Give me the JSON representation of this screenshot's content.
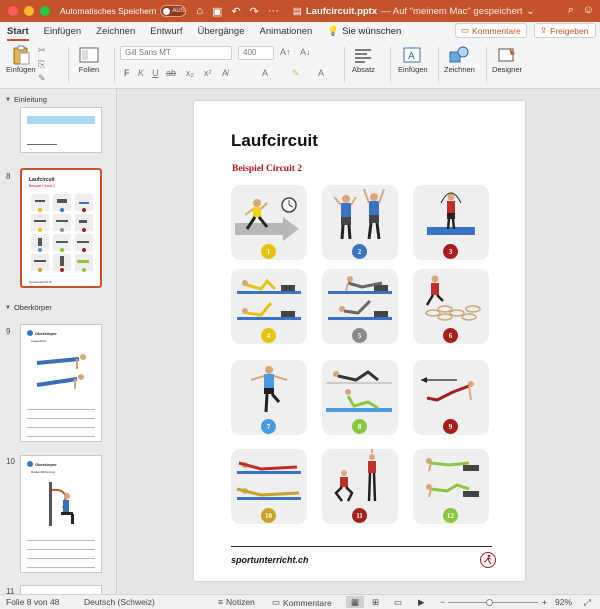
{
  "titlebar": {
    "autosave_label": "Automatisches Speichern",
    "autosave_toggle": "AUS",
    "file_name": "Laufcircuit.pptx",
    "saved_status": "— Auf \"meinem Mac\" gespeichert",
    "chevron": "⌄"
  },
  "tabs": [
    "Start",
    "Einfügen",
    "Zeichnen",
    "Entwurf",
    "Übergänge",
    "Animationen"
  ],
  "tellme": "Sie wünschen",
  "comments_button": "Kommentare",
  "share_button": "Freigeben",
  "ribbon": {
    "paste_label": "Einfügen",
    "slides_label": "Folien",
    "font_name": "Gill Sans MT",
    "font_size": "400",
    "paragraph_label": "Absatz",
    "insert_label": "Einfügen",
    "draw_label": "Zeichnen",
    "designer_label": "Designer"
  },
  "sidebar": {
    "sections": [
      {
        "label": "Einleitung"
      },
      {
        "label": "Oberkörper"
      }
    ],
    "slides": [
      {
        "number": "8"
      },
      {
        "number": "9",
        "title": "Oberkörper",
        "sub": "Liegestütze"
      },
      {
        "number": "10",
        "title": "Oberkörper",
        "sub": "Rudern/Klimmzug"
      },
      {
        "number": "11"
      }
    ],
    "thumb_footer": "sportunterricht.ch"
  },
  "slide": {
    "title": "Laufcircuit",
    "subtitle": "Beispiel Circuit 2",
    "footer": "sportunterricht.ch",
    "stations": [
      {
        "num": "1",
        "color": "#e8c20f"
      },
      {
        "num": "2",
        "color": "#3a73c4"
      },
      {
        "num": "3",
        "color": "#a51f1f"
      },
      {
        "num": "4",
        "color": "#e8c20f"
      },
      {
        "num": "5",
        "color": "#8a8a8a"
      },
      {
        "num": "6",
        "color": "#a51f1f"
      },
      {
        "num": "7",
        "color": "#4a9be0"
      },
      {
        "num": "8",
        "color": "#8cc63f"
      },
      {
        "num": "9",
        "color": "#a51f1f"
      },
      {
        "num": "10",
        "color": "#c9a227"
      },
      {
        "num": "11",
        "color": "#a51f1f"
      },
      {
        "num": "12",
        "color": "#8cc63f"
      }
    ]
  },
  "status": {
    "slide_position": "Folie 8 von 48",
    "language": "Deutsch (Schweiz)",
    "notes": "Notizen",
    "comments": "Kommentare",
    "zoom": "92%"
  }
}
